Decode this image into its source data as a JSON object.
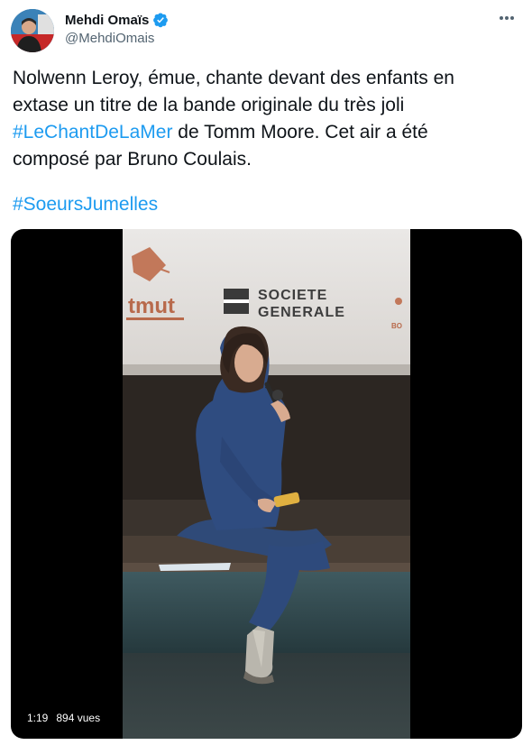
{
  "author": {
    "display_name": "Mehdi Omaïs",
    "handle": "@MehdiOmais",
    "verified": true
  },
  "tweet": {
    "text_lines": [
      [
        "Nolwenn Leroy, émue, chante devant des enfants en"
      ],
      [
        "extase un titre de la bande originale du très joli"
      ],
      [
        "#LeChantDeLaMer",
        " de Tomm Moore. Cet air a été"
      ],
      [
        "composé par Bruno Coulais."
      ]
    ],
    "hashtag_1": "#LeChantDeLaMer",
    "line3_rest": " de Tomm Moore. Cet air a été",
    "line1": "Nolwenn Leroy, émue, chante devant des enfants en",
    "line2": "extase un titre de la bande originale du très joli",
    "line4": "composé par Bruno Coulais.",
    "hashtag_2": "#SoeursJumelles"
  },
  "media": {
    "type": "video",
    "duration": "1:19",
    "views": "894 vues",
    "backdrop_texts": [
      "tmut",
      "SOCIETE",
      "GENERALE",
      "BO"
    ]
  },
  "colors": {
    "link": "#1d9bf0",
    "verified": "#1d9bf0",
    "secondary_text": "#536471"
  },
  "icons": {
    "verified": "verified-badge-icon",
    "more": "more-dots-icon"
  }
}
